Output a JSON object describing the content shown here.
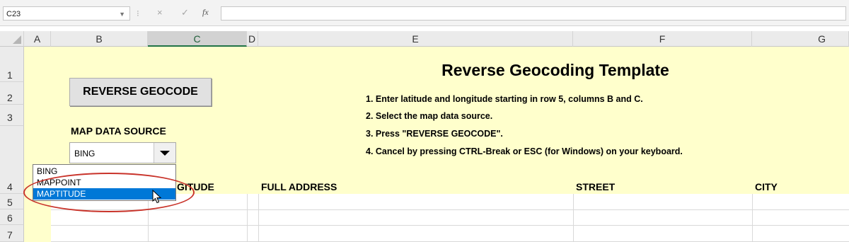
{
  "formula_bar": {
    "name_box": "C23",
    "fx_label": "fx",
    "cancel_glyph": "×",
    "enter_glyph": "✓",
    "formula": ""
  },
  "columns": [
    "A",
    "B",
    "C",
    "D",
    "E",
    "F",
    "G"
  ],
  "selected_column": "C",
  "rows": [
    "1",
    "2",
    "3",
    "4",
    "5",
    "6",
    "7"
  ],
  "sheet": {
    "title": "Reverse Geocoding Template",
    "instructions": [
      "1.  Enter latitude and longitude starting in row 5, columns B and C.",
      "2.  Select the map data source.",
      "3.  Press \"REVERSE GEOCODE\".",
      "4.  Cancel by pressing CTRL-Break or ESC (for Windows) on your keyboard."
    ],
    "reverse_geocode_button": "REVERSE GEOCODE",
    "map_data_source_label": "MAP DATA SOURCE",
    "combo_value": "BING",
    "dropdown_options": [
      "BING",
      "MAPPOINT",
      "MAPTITUDE"
    ],
    "highlighted_option": "MAPTITUDE",
    "headers": {
      "longitude_partial": "GITUDE",
      "full_address": "FULL ADDRESS",
      "street": "STREET",
      "city": "CITY"
    }
  },
  "colors": {
    "sheet_fill": "#ffffcc",
    "highlight": "#0078d7",
    "annotation_circle": "#c9342b",
    "selected_header": "#217346"
  },
  "icons": [
    "dropdown-arrow-icon",
    "cancel-icon",
    "enter-icon",
    "fx-icon",
    "mouse-pointer-icon"
  ]
}
